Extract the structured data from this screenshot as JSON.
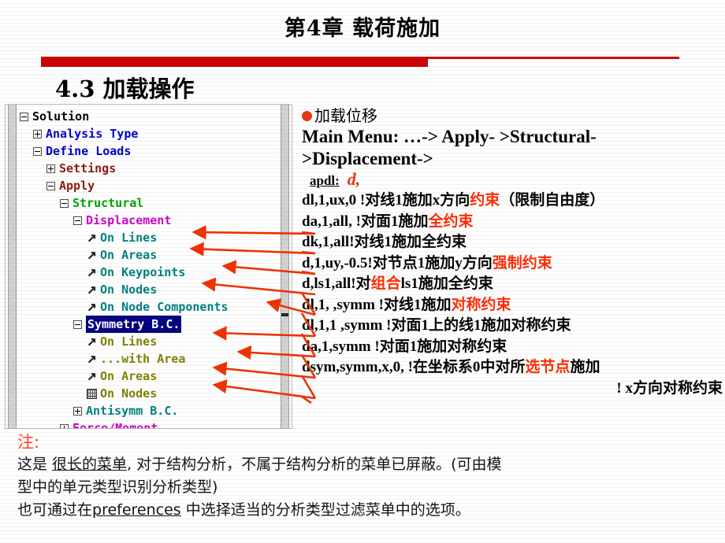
{
  "header": {
    "chapter_title": "第4章 载荷施加",
    "section_title": "4.3 加载操作",
    "rule_color": "#CC0000"
  },
  "tree_panel": {
    "nodes": [
      {
        "label": "Solution",
        "toggle": "minus",
        "icon": "none",
        "indent": 0,
        "color": "c-black",
        "selected": false
      },
      {
        "label": "Analysis Type",
        "toggle": "plus",
        "icon": "none",
        "indent": 1,
        "color": "c-blue",
        "selected": false
      },
      {
        "label": "Define Loads",
        "toggle": "minus",
        "icon": "none",
        "indent": 1,
        "color": "c-blue",
        "selected": false
      },
      {
        "label": "Settings",
        "toggle": "plus",
        "icon": "none",
        "indent": 2,
        "color": "c-darkred",
        "selected": false
      },
      {
        "label": "Apply",
        "toggle": "minus",
        "icon": "none",
        "indent": 2,
        "color": "c-darkred",
        "selected": false
      },
      {
        "label": "Structural",
        "toggle": "minus",
        "icon": "none",
        "indent": 3,
        "color": "c-green",
        "selected": false
      },
      {
        "label": "Displacement",
        "toggle": "minus",
        "icon": "none",
        "indent": 4,
        "color": "c-magenta",
        "selected": false
      },
      {
        "label": "On Lines",
        "toggle": "none",
        "icon": "arrow",
        "indent": 5,
        "color": "c-teal",
        "selected": false
      },
      {
        "label": "On Areas",
        "toggle": "none",
        "icon": "arrow",
        "indent": 5,
        "color": "c-teal",
        "selected": false
      },
      {
        "label": "On Keypoints",
        "toggle": "none",
        "icon": "arrow",
        "indent": 5,
        "color": "c-teal",
        "selected": false
      },
      {
        "label": "On Nodes",
        "toggle": "none",
        "icon": "arrow",
        "indent": 5,
        "color": "c-teal",
        "selected": false
      },
      {
        "label": "On Node Components",
        "toggle": "none",
        "icon": "arrow",
        "indent": 5,
        "color": "c-teal",
        "selected": false
      },
      {
        "label": "Symmetry B.C.",
        "toggle": "minus",
        "icon": "none",
        "indent": 4,
        "color": "c-blue",
        "selected": true
      },
      {
        "label": "On Lines",
        "toggle": "none",
        "icon": "arrow",
        "indent": 5,
        "color": "c-olive",
        "selected": false
      },
      {
        "label": "...with Area",
        "toggle": "none",
        "icon": "arrow",
        "indent": 5,
        "color": "c-olive",
        "selected": false
      },
      {
        "label": "On Areas",
        "toggle": "none",
        "icon": "arrow",
        "indent": 5,
        "color": "c-olive",
        "selected": false
      },
      {
        "label": "On Nodes",
        "toggle": "none",
        "icon": "grid",
        "indent": 5,
        "color": "c-olive",
        "selected": false
      },
      {
        "label": "Antisymm B.C.",
        "toggle": "plus",
        "icon": "none",
        "indent": 4,
        "color": "c-teal",
        "selected": false
      },
      {
        "label": "Force/Moment",
        "toggle": "plus",
        "icon": "none",
        "indent": 3,
        "color": "c-magenta",
        "selected": false
      }
    ]
  },
  "content": {
    "bullet_heading": "加载位移",
    "menu_path_line1": "Main Menu:  …-> Apply- >Structural-",
    "menu_path_line2": ">Displacement->",
    "apdl_label": "apdl:",
    "apdl_command": "d,",
    "commands": [
      {
        "pre": "dl,1,ux,0 !对线1施加x方向",
        "hl": "约束",
        "post": "（限制自由度）"
      },
      {
        "pre": "da,1,all,  !对面1施加",
        "hl": "全约束",
        "post": ""
      },
      {
        "pre": "dk,1,all!对线1施加全约束",
        "hl": "",
        "post": ""
      },
      {
        "pre": "d,1,uy,-0.5!对节点1施加y方向",
        "hl": "强制约束",
        "post": ""
      },
      {
        "pre": "d,ls1,all!对",
        "hl": "组合",
        "post": "ls1施加全约束"
      },
      {
        "pre": "dl,1, ,symm !对线1施加",
        "hl": "对称约束",
        "post": ""
      },
      {
        "pre": "dl,1,1 ,symm !对面1上的线1施加对称约束",
        "hl": "",
        "post": ""
      },
      {
        "pre": "da,1,symm !对面1施加对称约束",
        "hl": "",
        "post": ""
      },
      {
        "pre": "dsym,symm,x,0, !在坐标系0中对所",
        "hl": "选节点",
        "post": "施加"
      }
    ],
    "commands_tail": "! x方向对称约束"
  },
  "notes": {
    "label": "注:",
    "line1_a": "这是 ",
    "line1_ul": "很长的菜单",
    "line1_b": ", 对于结构分析，不属于结构分析的菜单已屏蔽。(可由模",
    "line2": "型中的单元类型识别分析类型)",
    "line3_a": "也可通过在",
    "line3_ul": "preferences",
    "line3_b": " 中选择适当的分析类型过滤菜单中的选项。"
  },
  "colors": {
    "highlight_red": "#FF2A00",
    "bullet_orange": "#E8380D",
    "selection_blue": "#000080",
    "arrow_red": "#F03000"
  }
}
